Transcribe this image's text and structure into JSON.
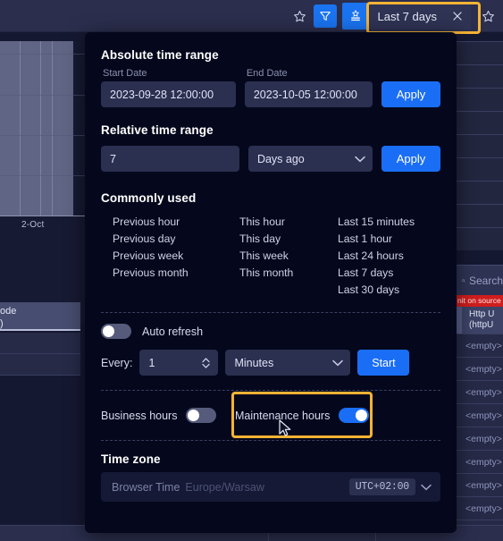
{
  "toolbar": {
    "favorite_icon": "star-icon",
    "filter_icon": "filter-icon",
    "time_chip_icon": "time-range-bookmark-icon",
    "time_chip_label": "Last 7 days",
    "close_icon": "close-icon",
    "bookmark_icon": "star-outline-icon"
  },
  "modal": {
    "absolute": {
      "title": "Absolute time range",
      "start_label": "Start Date",
      "start_value": "2023-09-28 12:00:00",
      "end_label": "End Date",
      "end_value": "2023-10-05 12:00:00",
      "apply_label": "Apply"
    },
    "relative": {
      "title": "Relative time range",
      "amount_value": "7",
      "unit_value": "Days ago",
      "apply_label": "Apply"
    },
    "commonly_used": {
      "title": "Commonly used",
      "columns": [
        [
          "Previous hour",
          "Previous day",
          "Previous week",
          "Previous month"
        ],
        [
          "This hour",
          "This day",
          "This week",
          "This month"
        ],
        [
          "Last 15 minutes",
          "Last 1 hour",
          "Last 24 hours",
          "Last 7 days",
          "Last 30 days"
        ]
      ]
    },
    "auto_refresh": {
      "label": "Auto refresh",
      "enabled": false,
      "every_label": "Every:",
      "every_value": "1",
      "unit_value": "Minutes",
      "start_label": "Start"
    },
    "hours": {
      "business_label": "Business hours",
      "business_enabled": false,
      "maintenance_label": "Maintenance hours",
      "maintenance_enabled": true
    },
    "timezone": {
      "title": "Time zone",
      "primary": "Browser Time",
      "secondary": "Europe/Warsaw",
      "offset": "UTC+02:00"
    }
  },
  "background": {
    "chart_tick": "2-Oct",
    "left_table_header_line1": "ode",
    "left_table_header_line2": ")",
    "right_table": {
      "search_placeholder": "Search",
      "search_icon": "search-icon",
      "alert_banner": "nit on source",
      "column_line1": "Http U",
      "column_line2": "(httpU",
      "empty_value": "<empty>",
      "empty_rows": 9
    }
  },
  "colors": {
    "accent_blue": "#1a6ef5",
    "highlight_orange": "#f5b335",
    "alert_red": "#d01d1d",
    "modal_bg": "#05081c",
    "topbar_bg": "#2b2e4d"
  }
}
